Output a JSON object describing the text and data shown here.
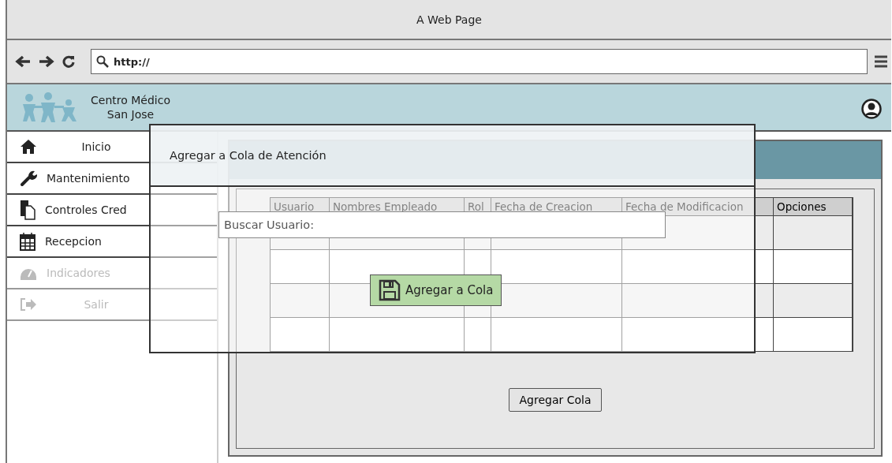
{
  "window": {
    "title": "A Web Page"
  },
  "address_bar": {
    "value": "http://"
  },
  "header": {
    "title_lines": [
      "Centro Médico",
      "San Jose"
    ]
  },
  "sidebar": {
    "items": [
      {
        "label": "Inicio",
        "disabled": false,
        "centered": true
      },
      {
        "label": "Mantenimiento",
        "disabled": false,
        "centered": false
      },
      {
        "label": "Controles Cred",
        "disabled": false,
        "centered": false
      },
      {
        "label": "Recepcion",
        "disabled": false,
        "centered": false
      },
      {
        "label": "Indicadores",
        "disabled": true,
        "centered": false
      },
      {
        "label": "Salir",
        "disabled": true,
        "centered": true
      }
    ]
  },
  "table": {
    "columns": [
      "Usuario",
      "Nombres Empleado",
      "Rol",
      "Fecha de Creacion",
      "Fecha de Modificacion",
      "Opciones"
    ],
    "rows": [
      {
        "shaded": true
      },
      {
        "shaded": false
      },
      {
        "shaded": true
      },
      {
        "shaded": false
      }
    ]
  },
  "main_button": "Agregar Cola",
  "dialog": {
    "title": "Agregar a Cola de Atención",
    "search": {
      "placeholder": "Buscar Usuario:"
    },
    "button": "Agregar a Cola"
  }
}
